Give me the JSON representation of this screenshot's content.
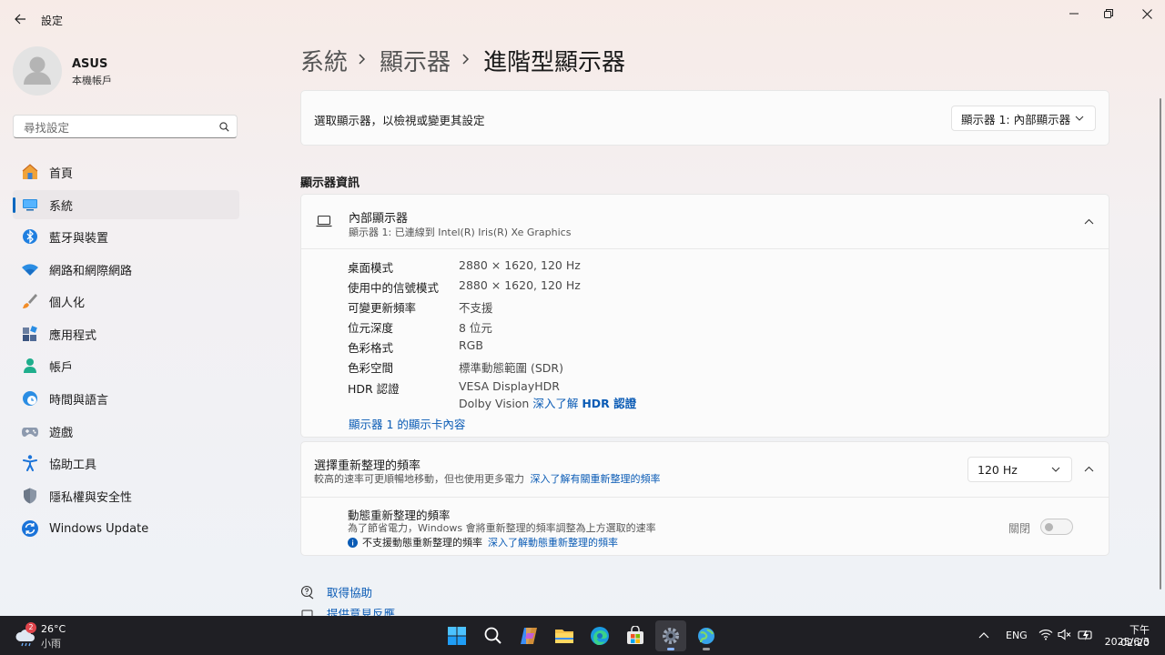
{
  "window": {
    "title": "設定"
  },
  "account": {
    "name": "ASUS",
    "type": "本機帳戶"
  },
  "search": {
    "placeholder": "尋找設定"
  },
  "sidebar": {
    "items": [
      {
        "label": "首頁",
        "icon": "home-icon"
      },
      {
        "label": "系統",
        "icon": "monitor-icon",
        "active": true
      },
      {
        "label": "藍牙與裝置",
        "icon": "bluetooth-icon"
      },
      {
        "label": "網路和網際網路",
        "icon": "wifi-icon"
      },
      {
        "label": "個人化",
        "icon": "brush-icon"
      },
      {
        "label": "應用程式",
        "icon": "apps-icon"
      },
      {
        "label": "帳戶",
        "icon": "person-icon"
      },
      {
        "label": "時間與語言",
        "icon": "clock-globe-icon"
      },
      {
        "label": "遊戲",
        "icon": "gamepad-icon"
      },
      {
        "label": "協助工具",
        "icon": "accessibility-icon"
      },
      {
        "label": "隱私權與安全性",
        "icon": "shield-icon"
      },
      {
        "label": "Windows Update",
        "icon": "update-icon"
      }
    ]
  },
  "breadcrumb": {
    "items": [
      "系統",
      "顯示器",
      "進階型顯示器"
    ],
    "separator": "›"
  },
  "select_display": {
    "label": "選取顯示器，以檢視或變更其設定",
    "value": "顯示器 1: 內部顯示器"
  },
  "display_info": {
    "section_title": "顯示器資訊",
    "name": "內部顯示器",
    "subtitle": "顯示器 1: 已連線到 Intel(R) Iris(R) Xe Graphics",
    "rows": [
      {
        "label": "桌面模式",
        "value": "2880 × 1620, 120 Hz"
      },
      {
        "label": "使用中的信號模式",
        "value": "2880 × 1620, 120 Hz"
      },
      {
        "label": "可變更新頻率",
        "value": "不支援"
      },
      {
        "label": "位元深度",
        "value": "8 位元"
      },
      {
        "label": "色彩格式",
        "value": "RGB"
      },
      {
        "label": "色彩空間",
        "value": "標準動態範圍 (SDR)"
      }
    ],
    "hdr_label": "HDR 認證",
    "hdr_value1": "VESA DisplayHDR",
    "hdr_value2_prefix": "Dolby Vision",
    "hdr_link_prefix": "深入了解",
    "hdr_link_bold": "HDR 認證",
    "adapter_link": "顯示器 1 的顯示卡內容"
  },
  "refresh": {
    "title": "選擇重新整理的頻率",
    "subtitle": "較高的速率可更順暢地移動，但也使用更多電力",
    "link": "深入了解有關重新整理的頻率",
    "value": "120 Hz"
  },
  "dynamic_refresh": {
    "title": "動態重新整理的頻率",
    "subtitle": "為了節省電力，Windows 會將重新整理的頻率調整為上方選取的速率",
    "note": "不支援動態重新整理的頻率",
    "note_link": "深入了解動態重新整理的頻率",
    "toggle_label": "關閉",
    "toggle_on": false
  },
  "footer_links": {
    "help": "取得協助",
    "feedback": "提供意見反應"
  },
  "taskbar": {
    "weather_temp": "26°C",
    "weather_desc": "小雨",
    "weather_badge": "2",
    "language": "ENG",
    "time": "下午 02:20",
    "date": "2025/6/3"
  },
  "colors": {
    "accent": "#0067c0",
    "link": "#0a5bb5"
  }
}
